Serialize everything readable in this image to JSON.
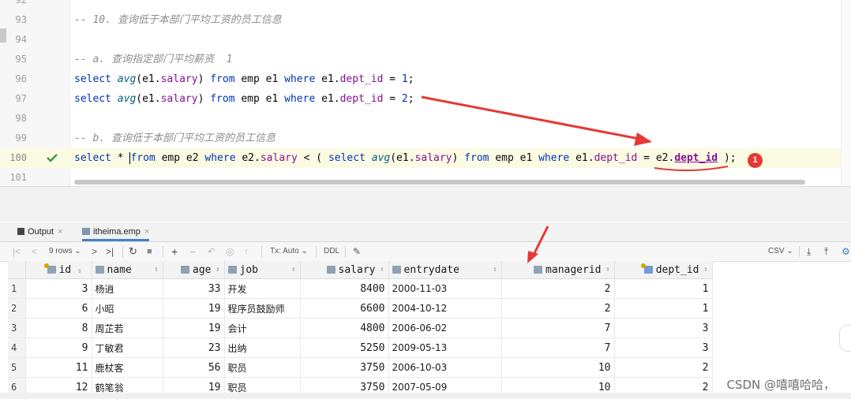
{
  "editor": {
    "lines": [
      {
        "n": "92",
        "html": ""
      },
      {
        "n": "93",
        "html": "<span class='cm'>-- 10. 查询低于本部门平均工资的员工信息</span>"
      },
      {
        "n": "94",
        "html": ""
      },
      {
        "n": "95",
        "html": "<span class='cm'>-- a. 查询指定部门平均薪资  1</span>"
      },
      {
        "n": "96",
        "html": "<span class='kw'>select</span> <span class='fn'>avg</span>(e1.<span class='fd'>salary</span>) <span class='kw'>from</span> emp e1 <span class='kw'>where</span> e1.<span class='fd'>dept_id</span> = <span class='kw'>1</span>;"
      },
      {
        "n": "97",
        "html": "<span class='kw'>select</span> <span class='fn'>avg</span>(e1.<span class='fd'>salary</span>) <span class='kw'>from</span> emp e1 <span class='kw'>where</span> e1.<span class='fd'>dept_id</span> = <span class='kw'>2</span>;"
      },
      {
        "n": "98",
        "html": ""
      },
      {
        "n": "99",
        "html": "<span class='cm'>-- b. 查询低于本部门平均工资的员工信息</span>"
      },
      {
        "n": "100",
        "html": "<span class='kw'>select</span> * <span class='caret'></span><span class='kw'>from</span> emp e2 <span class='kw'>where</span> e2.<span class='fd'>salary</span> &lt; ( <span class='kw'>select</span> <span class='fn'>avg</span>(e1.<span class='fd'>salary</span>) <span class='kw'>from</span> emp e1 <span class='kw'>where</span> e1.<span class='fd'>dept_id</span> = e2.<span class='underline-fd'>dept_id</span> );",
        "current": true
      },
      {
        "n": "101",
        "html": ""
      }
    ],
    "badge": "1"
  },
  "tabs": {
    "output": "Output",
    "emp": "itheima.emp"
  },
  "toolbar": {
    "rows": "9 rows",
    "tx": "Tx: Auto",
    "ddl": "DDL",
    "csv": "CSV"
  },
  "grid": {
    "columns": [
      "id",
      "name",
      "age",
      "job",
      "salary",
      "entrydate",
      "managerid",
      "dept_id"
    ],
    "rows": [
      [
        "1",
        "3",
        "杨逍",
        "33",
        "开发",
        "8400",
        "2000-11-03",
        "2",
        "1"
      ],
      [
        "2",
        "6",
        "小昭",
        "19",
        "程序员鼓励师",
        "6600",
        "2004-10-12",
        "2",
        "1"
      ],
      [
        "3",
        "8",
        "周芷若",
        "19",
        "会计",
        "4800",
        "2006-06-02",
        "7",
        "3"
      ],
      [
        "4",
        "9",
        "丁敏君",
        "23",
        "出纳",
        "5250",
        "2009-05-13",
        "7",
        "3"
      ],
      [
        "5",
        "11",
        "鹿杖客",
        "56",
        "职员",
        "3750",
        "2006-10-03",
        "10",
        "2"
      ],
      [
        "6",
        "12",
        "鹤笔翁",
        "19",
        "职员",
        "3750",
        "2007-05-09",
        "10",
        "2"
      ]
    ]
  },
  "watermark": "CSDN @嘻嘻哈哈，",
  "colors": {
    "keyword": "#0033b3",
    "field": "#871094",
    "comment": "#8c8c8c",
    "arrow": "#e53935"
  }
}
